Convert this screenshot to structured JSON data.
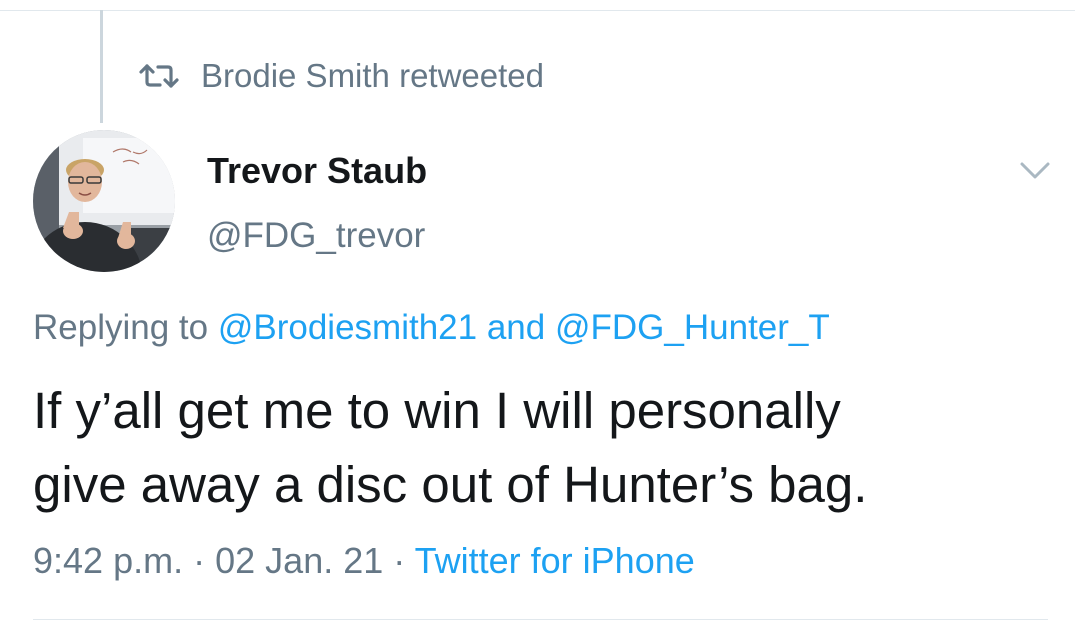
{
  "retweet": {
    "icon": "retweet-icon",
    "text": "Brodie Smith retweeted"
  },
  "author": {
    "avatar": "avatar-photo",
    "name": "Trevor Staub",
    "handle": "@FDG_trevor"
  },
  "menu": {
    "icon": "chevron-down-icon"
  },
  "reply": {
    "prefix": "Replying to",
    "mention1": "@Brodiesmith21",
    "conjunction": "and",
    "mention2": "@FDG_Hunter_T"
  },
  "tweet": {
    "line1": "If y’all get me to win I will personally",
    "line2": "give away a disc out of Hunter’s bag."
  },
  "meta": {
    "time": "9:42 p.m.",
    "separator": "·",
    "date": "02 Jan. 21",
    "source": "Twitter for iPhone"
  },
  "colors": {
    "link": "#1da1f2",
    "secondary_text": "#657786",
    "primary_text": "#14171a",
    "divider": "#e1e8ed"
  }
}
